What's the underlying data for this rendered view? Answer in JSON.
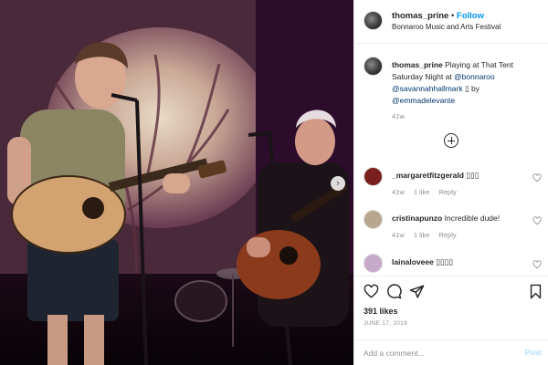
{
  "post": {
    "username": "thomas_prine",
    "follow_separator": "•",
    "follow_label": "Follow",
    "location": "Bonnaroo Music and Arts Festival",
    "caption_intro": "Playing at That Tent Saturday Night at ",
    "mention_1": "@bonnaroo",
    "mention_2": "@savannahhallmark",
    "caption_glyph": "▯",
    "caption_by": " by",
    "mention_3": "@emmadelevante",
    "caption_time": "41w"
  },
  "comments": [
    {
      "username": "_margaretfitzgerald",
      "text": "▯▯▯",
      "time": "41w",
      "likes": "1 like",
      "reply": "Reply",
      "avatar_color": "#7a1f1f"
    },
    {
      "username": "cristinapunzo",
      "text": "Incredible dude!",
      "time": "41w",
      "likes": "1 like",
      "reply": "Reply",
      "avatar_color": "#b8a68e"
    },
    {
      "username": "lainaloveee",
      "text": "▯▯▯▯",
      "time": "",
      "likes": "",
      "reply": "",
      "avatar_color": "#c7a9c9"
    }
  ],
  "actions": {
    "like_icon": "heart-icon",
    "comment_icon": "comment-icon",
    "share_icon": "paper-plane-icon",
    "save_icon": "bookmark-icon",
    "likes_count": "391 likes",
    "date": "JUNE 17, 2019"
  },
  "add_comment": {
    "placeholder": "Add a comment...",
    "post_label": "Post"
  },
  "photo": {
    "carousel_next": "›"
  },
  "colors": {
    "accent": "#0095f6",
    "mention": "#00376b",
    "muted": "#8e8e8e",
    "post_disabled": "#b2dffc"
  }
}
